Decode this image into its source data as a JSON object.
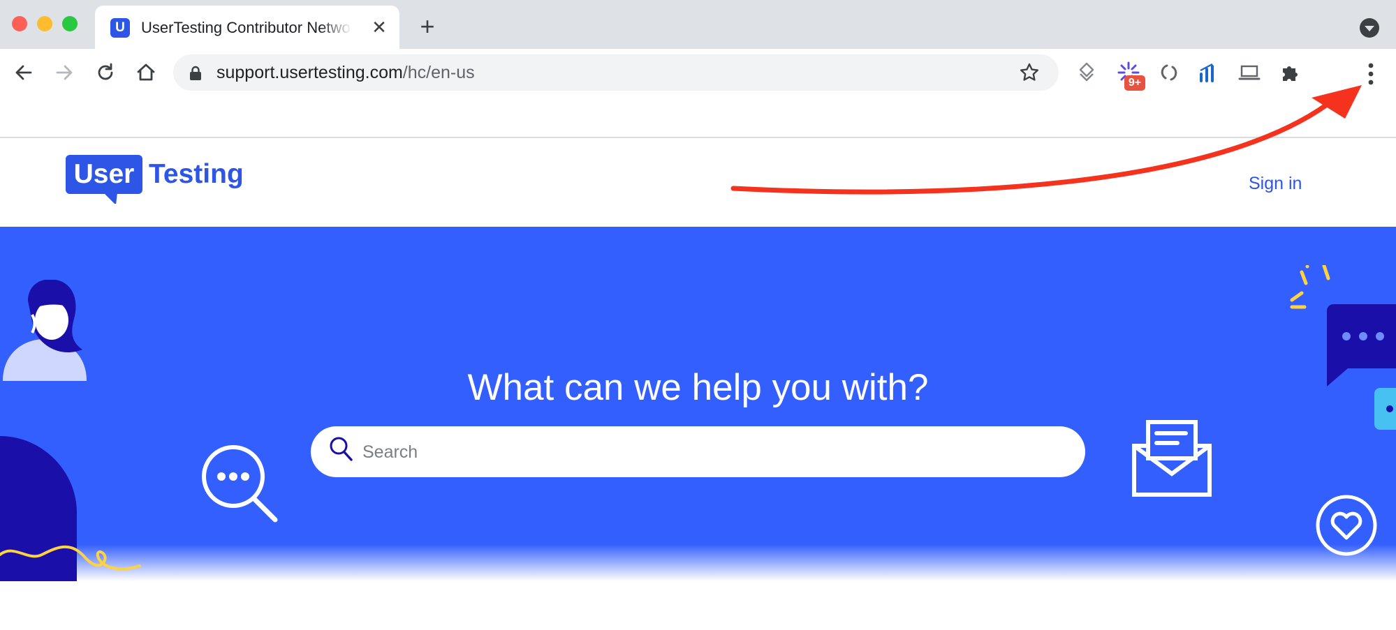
{
  "browser": {
    "tab": {
      "title": "UserTesting Contributor Netwo",
      "favicon_letter": "U"
    },
    "extensions_badge": "9+",
    "address": {
      "domain": "support.usertesting.com",
      "path": "/hc/en-us"
    },
    "icons": [
      "back-icon",
      "forward-icon",
      "reload-icon",
      "home-icon",
      "lock-icon",
      "star-icon",
      "puzzle-icon",
      "more-vert-icon"
    ]
  },
  "site": {
    "logo": {
      "left": "User",
      "right": "Testing"
    },
    "sign_in": "Sign in"
  },
  "hero": {
    "title": "What can we help you with?",
    "search_placeholder": "Search"
  },
  "colors": {
    "brand_blue": "#335ffe",
    "annotation_arrow": "#f5321e",
    "accent_yellow": "#ffd23f",
    "dark_navy": "#1a0fa8"
  }
}
